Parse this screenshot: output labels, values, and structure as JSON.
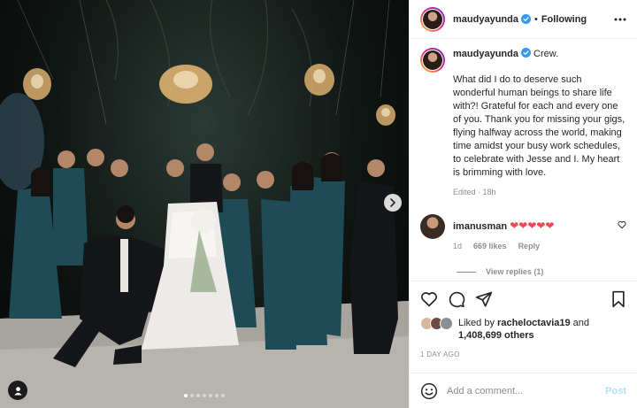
{
  "post": {
    "author": "maudyayunda",
    "following_label": "Following",
    "separator": "•",
    "caption_title": "Crew.",
    "caption_body": "What did I do to deserve such wonderful human beings to share life with?! Grateful for each and every one of you. Thank you for missing your gigs, flying halfway across the world, making time amidst your busy work schedules, to celebrate with Jesse and I. My heart is brimming with love.",
    "edited_label": "Edited",
    "edited_time": "18h",
    "likes_prefix": "Liked by",
    "liked_by_user": "racheloctavia19",
    "likes_suffix": "and",
    "likes_count": "1,408,699 others",
    "timestamp": "1 DAY AGO",
    "photo_count": 7,
    "photo_active_index": 0
  },
  "comments": [
    {
      "user": "imanusman",
      "text": "❤❤❤❤❤",
      "age": "1d",
      "likes": "669 likes",
      "reply_label": "Reply",
      "view_replies": "View replies (1)"
    }
  ],
  "composer": {
    "placeholder": "Add a comment...",
    "post_label": "Post"
  },
  "icons": {
    "more": "more-horizontal-icon",
    "verified": "verified-badge-icon",
    "like": "heart-icon",
    "comment": "comment-icon",
    "share": "share-icon",
    "save": "bookmark-icon",
    "emoji": "emoji-icon",
    "tag": "user-tag-icon",
    "next": "chevron-right-icon"
  },
  "colors": {
    "verified": "#3897f0",
    "heart": "#ed4956",
    "post_button_disabled": "#b2dffc",
    "secondary_text": "#8e8e8e"
  }
}
